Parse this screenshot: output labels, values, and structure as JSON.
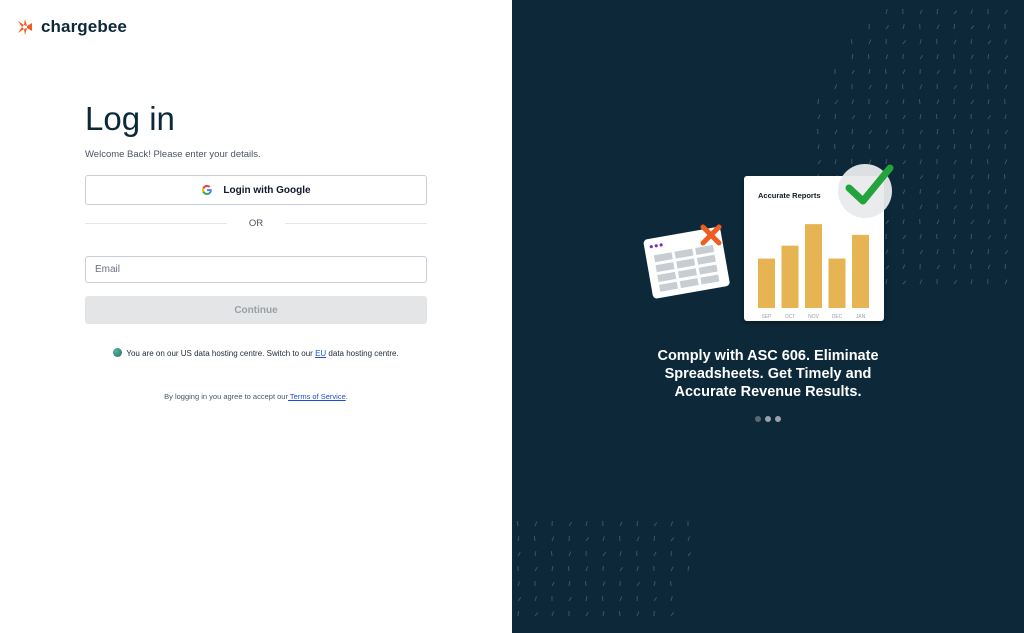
{
  "brand": {
    "name": "chargebee",
    "accent": "#f05d23"
  },
  "login": {
    "title": "Log in",
    "subtitle": "Welcome Back! Please enter your details.",
    "google_label": "Login with Google",
    "or_label": "OR",
    "email_placeholder": "Email",
    "email_value": "",
    "continue_label": "Continue"
  },
  "hosting": {
    "prefix": "You are on our US data hosting centre. Switch to our ",
    "link": "EU",
    "suffix": " data hosting centre."
  },
  "terms": {
    "prefix": "By logging in you agree to accept our",
    "link": " Terms of Service",
    "suffix": "."
  },
  "promo": {
    "background": "#0c2839",
    "card_title": "Accurate Reports",
    "headline_lines": [
      "Comply with ASC 606. Eliminate",
      "Spreadsheets. Get Timely and",
      "Accurate Revenue Results."
    ],
    "carousel": {
      "total": 3,
      "active_index": 0
    }
  },
  "chart_data": {
    "type": "bar",
    "title": "Accurate Reports",
    "categories": [
      "SEP",
      "OCT",
      "NOV",
      "DEC",
      "JAN"
    ],
    "values": [
      46,
      58,
      78,
      46,
      68
    ],
    "ylim": [
      0,
      80
    ],
    "bar_color": "#e7b453"
  }
}
